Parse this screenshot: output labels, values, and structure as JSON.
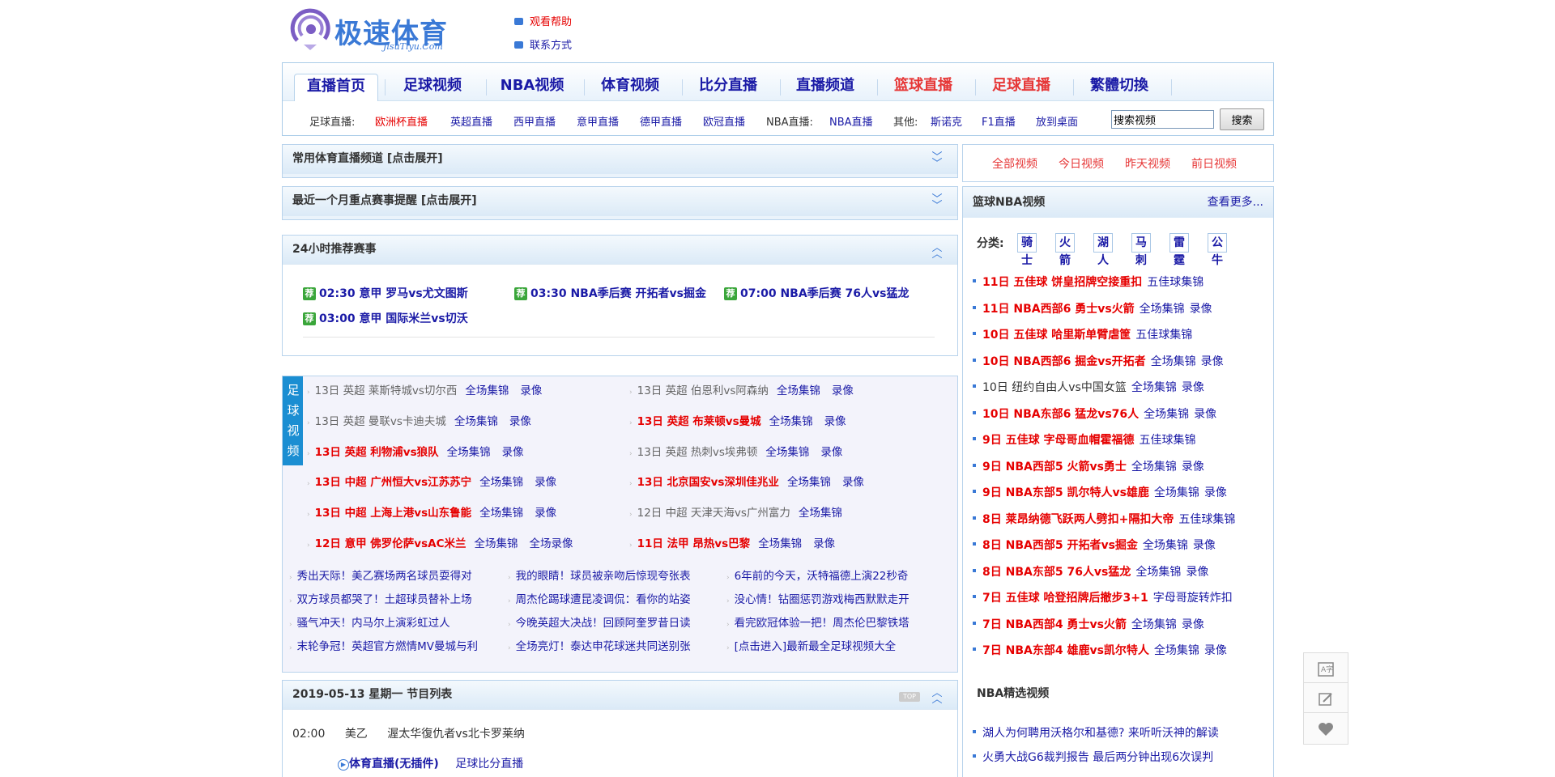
{
  "header": {
    "logo_text": "极速体育",
    "logo_sub": "JisuTiyu.Com",
    "help_link": "观看帮助",
    "contact_link": "联系方式"
  },
  "nav": {
    "tabs": [
      {
        "label": "直播首页",
        "active": true,
        "hot": false
      },
      {
        "label": "足球视频",
        "active": false,
        "hot": false
      },
      {
        "label": "NBA视频",
        "active": false,
        "hot": false
      },
      {
        "label": "体育视频",
        "active": false,
        "hot": false
      },
      {
        "label": "比分直播",
        "active": false,
        "hot": false
      },
      {
        "label": "直播频道",
        "active": false,
        "hot": false
      },
      {
        "label": "篮球直播",
        "active": false,
        "hot": true
      },
      {
        "label": "足球直播",
        "active": false,
        "hot": true
      },
      {
        "label": "繁體切換",
        "active": false,
        "hot": false
      }
    ],
    "sub": {
      "football_label": "足球直播:",
      "euro": "欧洲杯直播",
      "links": [
        "英超直播",
        "西甲直播",
        "意甲直播",
        "德甲直播",
        "欧冠直播"
      ],
      "nba_label": "NBA直播:",
      "nba_link": "NBA直播",
      "other_label": "其他:",
      "other_links": [
        "斯诺克",
        "F1直播",
        "放到桌面"
      ]
    },
    "search": {
      "value": "搜索视频",
      "button": "搜索"
    }
  },
  "panels": {
    "channels": "常用体育直播频道 [点击展开]",
    "month": "最近一个月重点赛事提醒 [点击展开]",
    "rec_title": "24小时推荐赛事",
    "rec_badge": "荐",
    "rec_items": [
      "02:30 意甲 罗马vs尤文图斯",
      "03:30 NBA季后赛 开拓者vs掘金",
      "07:00 NBA季后赛 76人vs猛龙",
      "03:00 意甲 国际米兰vs切沃"
    ]
  },
  "football_videos": {
    "tab": "足球视频",
    "items": [
      {
        "title": "13日 英超 莱斯特城vs切尔西",
        "hot": false,
        "links": [
          "全场集锦",
          "录像"
        ]
      },
      {
        "title": "13日 英超 伯恩利vs阿森纳",
        "hot": false,
        "links": [
          "全场集锦",
          "录像"
        ]
      },
      {
        "title": "13日 英超 曼联vs卡迪夫城",
        "hot": false,
        "links": [
          "全场集锦",
          "录像"
        ]
      },
      {
        "title": "13日 英超 布莱顿vs曼城",
        "hot": true,
        "links": [
          "全场集锦",
          "录像"
        ]
      },
      {
        "title": "13日 英超 利物浦vs狼队",
        "hot": true,
        "links": [
          "全场集锦",
          "录像"
        ]
      },
      {
        "title": "13日 英超 热刺vs埃弗顿",
        "hot": false,
        "links": [
          "全场集锦",
          "录像"
        ]
      },
      {
        "title": "13日 中超 广州恒大vs江苏苏宁",
        "hot": true,
        "links": [
          "全场集锦",
          "录像"
        ]
      },
      {
        "title": "13日 北京国安vs深圳佳兆业",
        "hot": true,
        "links": [
          "全场集锦",
          "录像"
        ]
      },
      {
        "title": "13日 中超 上海上港vs山东鲁能",
        "hot": true,
        "links": [
          "全场集锦",
          "录像"
        ]
      },
      {
        "title": "12日 中超 天津天海vs广州富力",
        "hot": false,
        "links": [
          "全场集锦"
        ]
      },
      {
        "title": "12日 意甲 佛罗伦萨vsAC米兰",
        "hot": true,
        "links": [
          "全场集锦",
          "全场录像"
        ]
      },
      {
        "title": "11日 法甲 昂热vs巴黎",
        "hot": true,
        "links": [
          "全场集锦",
          "录像"
        ]
      }
    ],
    "news": [
      "秀出天际！美乙赛场两名球员耍得对",
      "我的眼睛！球员被亲吻后惊现夸张表",
      "6年前的今天，沃特福德上演22秒奇",
      "双方球员都哭了！土超球员替补上场",
      "周杰伦踢球遭昆凌调侃：看你的站姿",
      "没心情！钻圈惩罚游戏梅西默默走开",
      "骚气冲天！内马尔上演彩虹过人",
      "今晚英超大决战！回顾阿奎罗昔日读",
      "看完欧冠体验一把！周杰伦巴黎铁塔",
      "末轮争冠！英超官方燃情MV曼城与利",
      "全场亮灯！泰达申花球迷共同送别张",
      "[点击进入]最新最全足球视频大全"
    ]
  },
  "program": {
    "title": "2019-05-13 星期一 节目列表",
    "top_badge": "TOP",
    "time": "02:00",
    "league": "美乙",
    "match": "渥太华復仇者vs北卡罗莱纳",
    "live": "体育直播(无插件)",
    "score": "足球比分直播"
  },
  "right": {
    "tabs": [
      "全部视频",
      "今日视频",
      "昨天视频",
      "前日视频"
    ],
    "box_title": "篮球NBA视频",
    "more": "查看更多...",
    "cat_label": "分类:",
    "cats": [
      "骑士",
      "火箭",
      "湖人",
      "马刺",
      "雷霆",
      "公牛"
    ],
    "items": [
      {
        "title": "11日 五佳球 饼皇招牌空接重扣",
        "hot": true,
        "links": [
          "五佳球集锦"
        ]
      },
      {
        "title": "11日 NBA西部6 勇士vs火箭",
        "hot": true,
        "links": [
          "全场集锦",
          "录像"
        ]
      },
      {
        "title": "10日 五佳球 哈里斯单臂虐筐",
        "hot": true,
        "links": [
          "五佳球集锦"
        ]
      },
      {
        "title": "10日 NBA西部6 掘金vs开拓者",
        "hot": true,
        "links": [
          "全场集锦",
          "录像"
        ]
      },
      {
        "title": "10日 纽约自由人vs中国女篮",
        "hot": false,
        "links": [
          "全场集锦",
          "录像"
        ]
      },
      {
        "title": "10日 NBA东部6 猛龙vs76人",
        "hot": true,
        "links": [
          "全场集锦",
          "录像"
        ]
      },
      {
        "title": "9日 五佳球 字母哥血帽霍福德",
        "hot": true,
        "links": [
          "五佳球集锦"
        ]
      },
      {
        "title": "9日 NBA西部5 火箭vs勇士",
        "hot": true,
        "links": [
          "全场集锦",
          "录像"
        ]
      },
      {
        "title": "9日 NBA东部5 凯尔特人vs雄鹿",
        "hot": true,
        "links": [
          "全场集锦",
          "录像"
        ]
      },
      {
        "title": "8日 莱昂纳德飞跃两人劈扣+隔扣大帝",
        "hot": true,
        "links": [
          "五佳球集锦"
        ]
      },
      {
        "title": "8日 NBA西部5 开拓者vs掘金",
        "hot": true,
        "links": [
          "全场集锦",
          "录像"
        ]
      },
      {
        "title": "8日 NBA东部5 76人vs猛龙",
        "hot": true,
        "links": [
          "全场集锦",
          "录像"
        ]
      },
      {
        "title": "7日 五佳球 哈登招牌后撤步3+1",
        "hot": true,
        "links": [
          "字母哥旋转炸扣"
        ]
      },
      {
        "title": "7日 NBA西部4 勇士vs火箭",
        "hot": true,
        "links": [
          "全场集锦",
          "录像"
        ]
      },
      {
        "title": "7日 NBA东部4 雄鹿vs凯尔特人",
        "hot": true,
        "links": [
          "全场集锦",
          "录像"
        ]
      }
    ],
    "nba_title": "NBA精选视频",
    "nba_news": [
      "湖人为何聘用沃格尔和基德? 来听听沃神的解读",
      "火勇大战G6裁判报告 最后两分钟出现6次误判"
    ]
  },
  "tools": [
    "translate-icon",
    "edit-icon",
    "heart-icon"
  ]
}
